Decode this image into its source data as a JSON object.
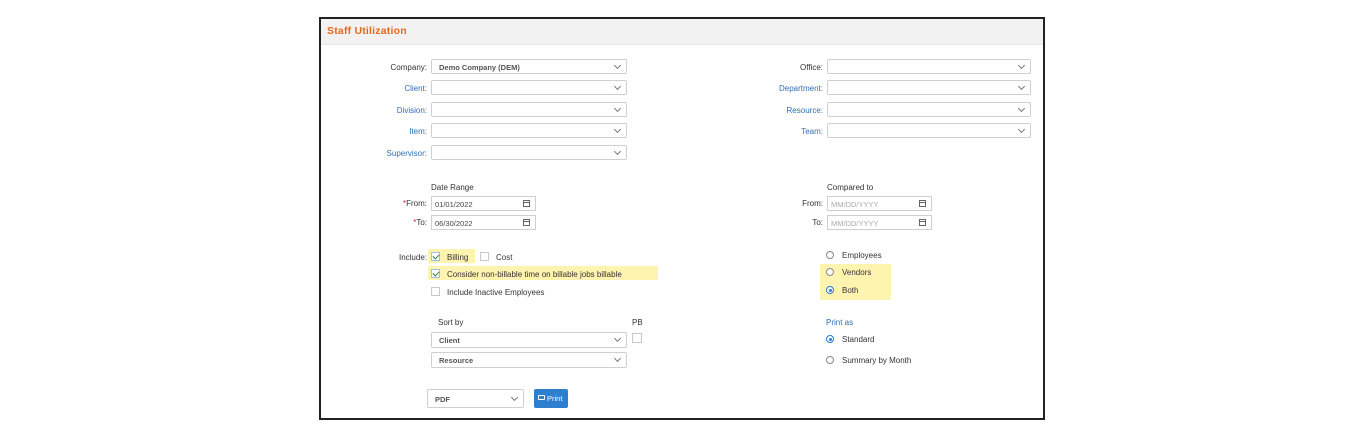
{
  "panel": {
    "title": "Staff Utilization"
  },
  "filters": {
    "company": {
      "label": "Company:",
      "value": "Demo Company (DEM)"
    },
    "client": {
      "label": "Client:",
      "value": ""
    },
    "division": {
      "label": "Division:",
      "value": ""
    },
    "item": {
      "label": "Item:",
      "value": ""
    },
    "supervisor": {
      "label": "Supervisor:",
      "value": ""
    },
    "office": {
      "label": "Office:",
      "value": ""
    },
    "department": {
      "label": "Department:",
      "value": ""
    },
    "resource": {
      "label": "Resource:",
      "value": ""
    },
    "team": {
      "label": "Team:",
      "value": ""
    }
  },
  "date_range": {
    "heading": "Date Range",
    "required_mark": "*",
    "from_label": "From:",
    "from_value": "01/01/2022",
    "to_label": "To:",
    "to_value": "06/30/2022"
  },
  "compared_to": {
    "heading": "Compared to",
    "from_label": "From:",
    "from_placeholder": "MM/DD/YYYY",
    "to_label": "To:",
    "to_placeholder": "MM/DD/YYYY"
  },
  "include": {
    "label": "Include:",
    "billing": {
      "label": "Billing",
      "checked": true
    },
    "cost": {
      "label": "Cost",
      "checked": false
    },
    "nonbillable": {
      "label": "Consider non-billable time on billable jobs billable",
      "checked": true
    },
    "inactive": {
      "label": "Include Inactive Employees",
      "checked": false
    }
  },
  "employee_type": {
    "options": [
      "Employees",
      "Vendors",
      "Both"
    ],
    "selected": "Both"
  },
  "sort": {
    "heading": "Sort by",
    "pb_label": "PB",
    "first": "Client",
    "second": "Resource"
  },
  "print_as": {
    "heading": "Print as",
    "options": [
      "Standard",
      "Summary by Month"
    ],
    "selected": "Standard"
  },
  "output": {
    "format": "PDF",
    "print_label": "Print"
  },
  "colors": {
    "title": "#e8671a",
    "link_label": "#2f6fb7",
    "highlight": "#fff3b0",
    "primary_button": "#2f7fd1",
    "required": "#d9232d"
  }
}
